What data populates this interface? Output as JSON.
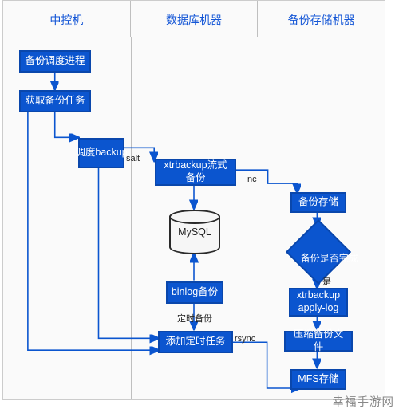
{
  "lanes": {
    "left": "中控机",
    "mid": "数据库机器",
    "right": "备份存储机器"
  },
  "nodes": {
    "schedProc": "备份调度进程",
    "getTask": "获取备份任务",
    "schedBackup": "调度backup",
    "xtraStream": "xtrbackup流式\n备份",
    "mysql": "MySQL",
    "binlog": "binlog备份",
    "addCron": "添加定时任务",
    "backupStore": "备份存储",
    "isDone": "备份是否完成",
    "applyLog": "xtrbackup\napply-log",
    "compress": "压缩备份文件",
    "mfs": "MFS存储"
  },
  "edges": {
    "salt": "salt",
    "nc": "nc",
    "yes": "是",
    "timed": "定时备份",
    "rsync": "rsync"
  },
  "watermark": "幸福手游网"
}
